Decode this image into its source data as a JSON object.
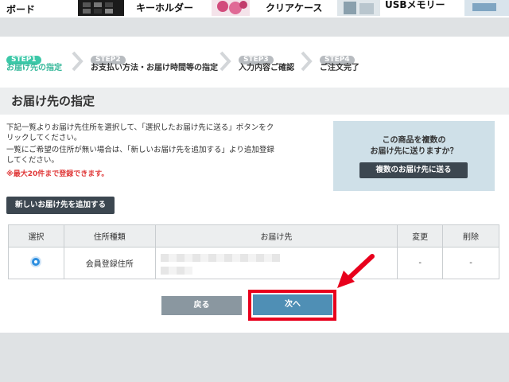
{
  "products": [
    {
      "label_line1": "",
      "label_line2": "ボード"
    },
    {
      "label": "キーホルダー"
    },
    {
      "label": "クリアケース"
    },
    {
      "label": "USBメモリー"
    }
  ],
  "steps": [
    {
      "badge": "STEP1",
      "label": "お届け先の指定",
      "active": true
    },
    {
      "badge": "STEP2",
      "label": "お支払い方法・お届け時間等の指定",
      "active": false
    },
    {
      "badge": "STEP3",
      "label": "入力内容ご確認",
      "active": false
    },
    {
      "badge": "STEP4",
      "label": "ご注文完了",
      "active": false
    }
  ],
  "page_title": "お届け先の指定",
  "instructions": {
    "line1": "下記一覧よりお届け先住所を選択して、「選択したお届け先に送る」ボタンをク",
    "line2": "リックしてください。",
    "line3": "一覧にご希望の住所が無い場合は、「新しいお届け先を追加する」より追加登録",
    "line4": "してください。",
    "note": "※最大20件まで登録できます。"
  },
  "multi_box": {
    "line1": "この商品を複数の",
    "line2": "お届け先に送りますか？",
    "button": "複数のお届け先に送る"
  },
  "add_button": "新しいお届け先を追加する",
  "table": {
    "headers": [
      "選択",
      "住所種類",
      "お届け先",
      "変更",
      "削除"
    ],
    "rows": [
      {
        "type": "会員登録住所",
        "edit": "-",
        "delete": "-"
      }
    ]
  },
  "buttons": {
    "back": "戻る",
    "next": "次へ"
  },
  "colors": {
    "accent_step": "#3cc8a8",
    "highlight": "#e8001c",
    "next_button": "#4f8fb5"
  }
}
